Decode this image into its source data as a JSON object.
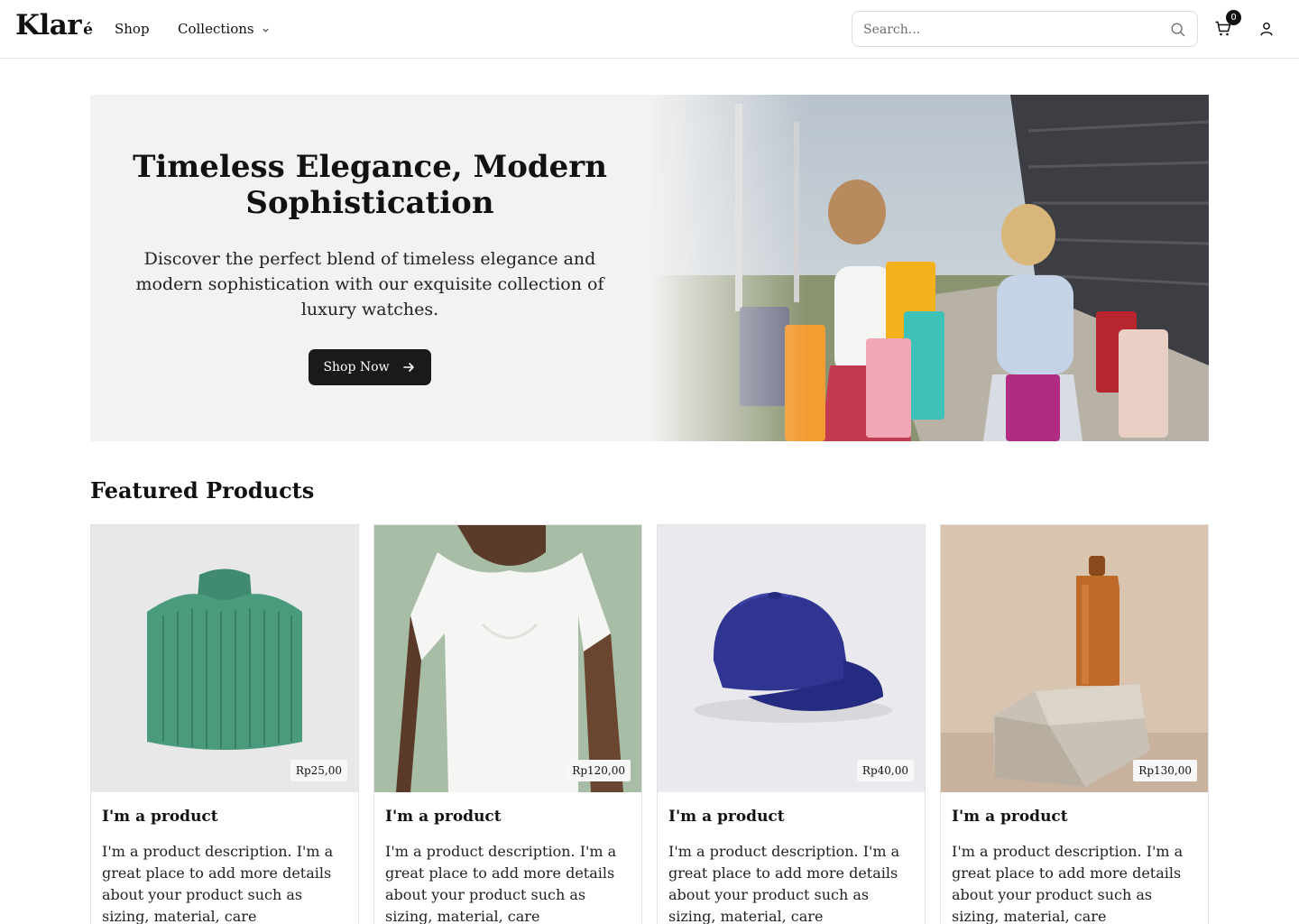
{
  "brand": {
    "name": "Klar",
    "accent": "é"
  },
  "nav": {
    "shop": "Shop",
    "collections": "Collections"
  },
  "search": {
    "placeholder": "Search..."
  },
  "cart": {
    "count": "0"
  },
  "hero": {
    "title": "Timeless Elegance, Modern Sophistication",
    "subtitle": "Discover the perfect blend of timeless elegance and modern sophistication with our exquisite collection of luxury watches.",
    "button_label": "Shop Now"
  },
  "featured": {
    "title": "Featured Products",
    "products": [
      {
        "name": "I'm a product",
        "price": "Rp25,00",
        "description": "I'm a product description. I'm a great place to add more details about your product such as sizing, material, care instructions and..."
      },
      {
        "name": "I'm a product",
        "price": "Rp120,00",
        "description": "I'm a product description. I'm a great place to add more details about your product such as sizing, material, care instructions and..."
      },
      {
        "name": "I'm a product",
        "price": "Rp40,00",
        "description": "I'm a product description. I'm a great place to add more details about your product such as sizing, material, care instructions and..."
      },
      {
        "name": "I'm a product",
        "price": "Rp130,00",
        "description": "I'm a product description. I'm a great place to add more details about your product such as sizing, material, care instructions and..."
      }
    ]
  },
  "colors": {
    "accent": "#1a1a1a",
    "hero_bg": "#f2f2f2",
    "border": "#e2e2e2"
  },
  "icons": {
    "search": "search-icon",
    "cart": "cart-icon",
    "user": "user-icon",
    "chevron": "chevron-down-icon",
    "arrow": "arrow-right-icon"
  }
}
